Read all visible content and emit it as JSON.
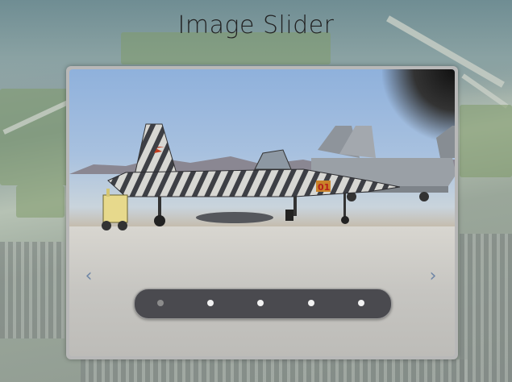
{
  "page": {
    "title": "Image Slider"
  },
  "slider": {
    "prev_glyph": "‹",
    "next_glyph": "›",
    "slide_count": 5,
    "active_index": 0,
    "aircraft_tail_number": "01"
  },
  "colors": {
    "pager_bg": "#4a4a4f",
    "dot": "#f2f2f2",
    "dot_active": "#8c8c8c",
    "arrow": "#6f86a6"
  }
}
